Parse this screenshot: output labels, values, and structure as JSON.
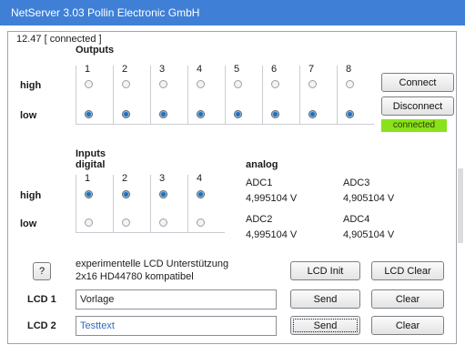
{
  "window": {
    "title": "NetServer 3.03    Pollin Electronic GmbH",
    "panel_title": "12.47 [ connected ]"
  },
  "outputs": {
    "heading": "Outputs",
    "row_high": "high",
    "row_low": "low",
    "channels": [
      "1",
      "2",
      "3",
      "4",
      "5",
      "6",
      "7",
      "8"
    ],
    "states": [
      "low",
      "low",
      "low",
      "low",
      "low",
      "low",
      "low",
      "low"
    ]
  },
  "connection": {
    "connect_label": "Connect",
    "disconnect_label": "Disconnect",
    "status_text": "connected"
  },
  "inputs": {
    "heading": "Inputs",
    "subheading": "digital",
    "row_high": "high",
    "row_low": "low",
    "channels": [
      "1",
      "2",
      "3",
      "4"
    ],
    "states": [
      "high",
      "high",
      "high",
      "high"
    ]
  },
  "analog": {
    "heading": "analog",
    "channels": [
      {
        "label": "ADC1",
        "value": "4,995104 V"
      },
      {
        "label": "ADC3",
        "value": "4,905104 V"
      },
      {
        "label": "ADC2",
        "value": "4,995104 V"
      },
      {
        "label": "ADC4",
        "value": "4,905104 V"
      }
    ]
  },
  "lcd": {
    "help_label": "?",
    "description_line1": "experimentelle LCD Unterstützung",
    "description_line2": "2x16 HD44780 kompatibel",
    "init_label": "LCD Init",
    "clear_all_label": "LCD Clear",
    "row1_label": "LCD 1",
    "row1_value": "Vorlage",
    "row2_label": "LCD 2",
    "row2_value": "Testtext",
    "send_label": "Send",
    "clear_label": "Clear"
  }
}
